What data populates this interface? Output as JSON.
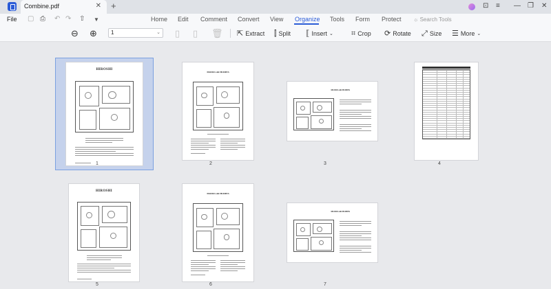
{
  "tab": {
    "title": "Combine.pdf"
  },
  "menu": {
    "file": "File",
    "items": [
      "Home",
      "Edit",
      "Comment",
      "Convert",
      "View",
      "Organize",
      "Tools",
      "Form",
      "Protect"
    ],
    "active": "Organize",
    "search_placeholder": "Search Tools"
  },
  "toolbar": {
    "page_value": "1",
    "extract": "Extract",
    "split": "Split",
    "insert": "Insert",
    "crop": "Crop",
    "rotate": "Rotate",
    "size": "Size",
    "more": "More"
  },
  "pages": [
    {
      "number": "1",
      "orientation": "portrait",
      "kind": "plan-a",
      "selected": true,
      "heading": "HIROSHI"
    },
    {
      "number": "2",
      "orientation": "portrait",
      "kind": "plan-b",
      "selected": false,
      "heading": "MODULAR HOMES"
    },
    {
      "number": "3",
      "orientation": "landscape",
      "kind": "plan-c",
      "selected": false,
      "heading": "MODULAR HOMES"
    },
    {
      "number": "4",
      "orientation": "portrait",
      "kind": "table",
      "selected": false,
      "heading": ""
    },
    {
      "number": "5",
      "orientation": "portrait",
      "kind": "plan-a",
      "selected": false,
      "heading": "HIROSHI"
    },
    {
      "number": "6",
      "orientation": "portrait",
      "kind": "plan-b",
      "selected": false,
      "heading": "MODULAR HOMES"
    },
    {
      "number": "7",
      "orientation": "landscape",
      "kind": "plan-c",
      "selected": false,
      "heading": "MODULAR HOMES"
    }
  ],
  "colors": {
    "accent": "#2a5bd7",
    "selection": "#c5d2ec",
    "workspace": "#e8e9ec"
  }
}
